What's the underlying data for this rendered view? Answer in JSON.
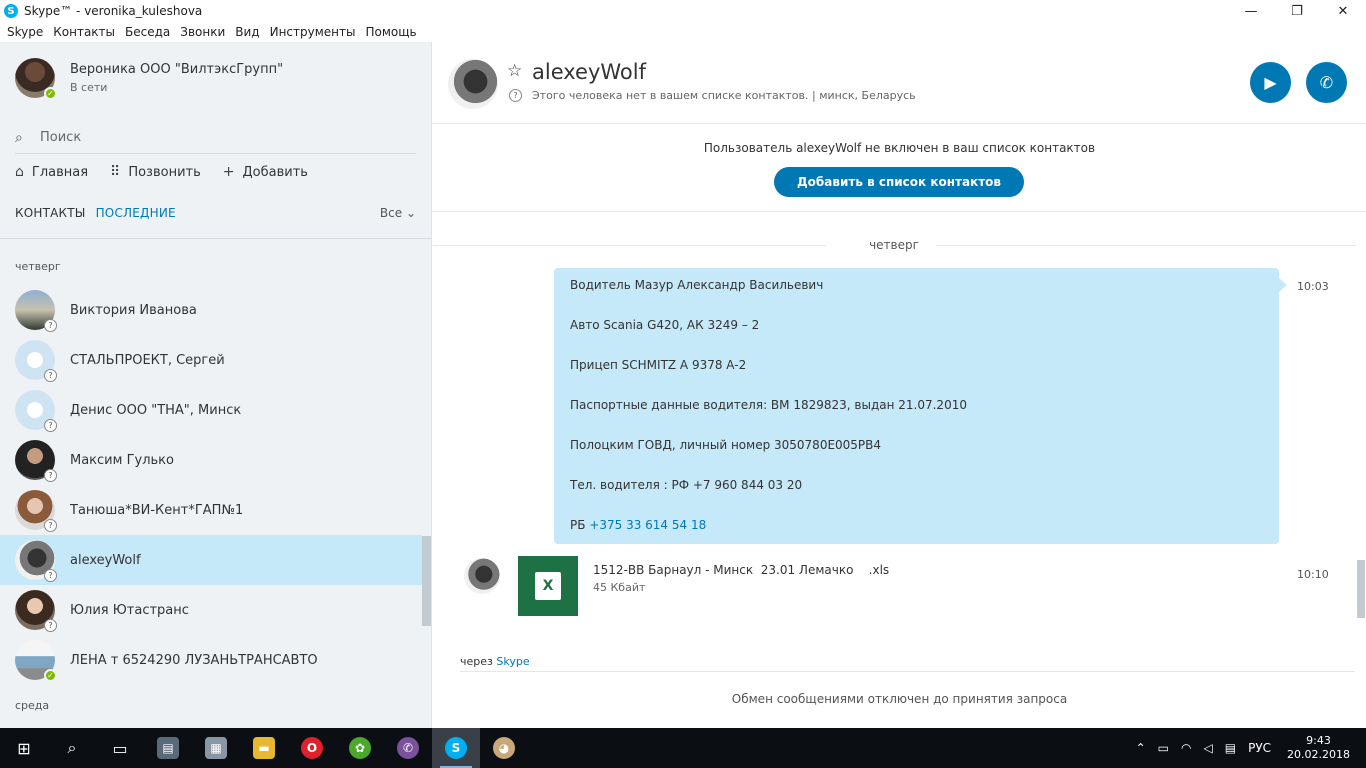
{
  "window": {
    "title": "Skype™ - veronika_kuleshova",
    "controls": {
      "minimize": "—",
      "restore": "❐",
      "close": "✕"
    }
  },
  "menu": [
    "Skype",
    "Контакты",
    "Беседа",
    "Звонки",
    "Вид",
    "Инструменты",
    "Помощь"
  ],
  "profile": {
    "name": "Вероника ООО \"ВилтэксГрупп\"",
    "status": "В сети"
  },
  "search": {
    "placeholder": "Поиск"
  },
  "nav": {
    "home": "Главная",
    "call": "Позвонить",
    "add": "Добавить"
  },
  "tabs": {
    "contacts": "КОНТАКТЫ",
    "recent": "ПОСЛЕДНИЕ",
    "filter": "Все"
  },
  "day_groups": {
    "thursday": "четверг",
    "wednesday": "среда"
  },
  "contacts": [
    {
      "name": "Виктория Иванова",
      "status": "unknown"
    },
    {
      "name": "СТАЛЬПРОЕКТ, Сергей",
      "status": "unknown"
    },
    {
      "name": "Денис ООО \"ТНА\", Минск",
      "status": "unknown"
    },
    {
      "name": "Максим Гулько",
      "status": "unknown"
    },
    {
      "name": "Танюша*ВИ-Кент*ГАП№1",
      "status": "unknown"
    },
    {
      "name": "alexeyWolf",
      "status": "unknown",
      "selected": true
    },
    {
      "name": "Юлия Ютастранс",
      "status": "unknown"
    },
    {
      "name": "ЛЕНА т 6524290 ЛУЗАНЬТРАНСАВТО",
      "status": "online"
    }
  ],
  "conversation": {
    "contact_name": "alexeyWolf",
    "info": "Этого человека нет в вашем списке контактов.",
    "location": "минск, Беларусь",
    "separator": "|",
    "notice": "Пользователь alexeyWolf не включен в ваш список контактов",
    "add_button": "Добавить в список контактов",
    "day_label": "четверг",
    "message": {
      "time": "10:03",
      "lines": [
        "Водитель Мазур Александр Васильевич",
        "Авто Scania G420, АК 3249 – 2",
        "Прицеп SCHMITZ A 9378 A-2",
        "Паспортные данные водителя: ВМ 1829823, выдан 21.07.2010",
        "Полоцким ГОВД, личный номер 3050780E005PB4",
        "Тел. водителя : РФ +7 960 844 03 20"
      ],
      "last_prefix": "РБ ",
      "last_phone": "+375 33 614 54 18"
    },
    "file": {
      "name": "1512-ВВ Барнаул - Минск  23.01 Лемачко    .xls",
      "size": "45 Кбайт",
      "time": "10:10",
      "icon_letter": "X"
    },
    "via_prefix": "через ",
    "via_link": "Skype",
    "footer": "Обмен сообщениями отключен до принятия запроса"
  },
  "taskbar": {
    "language": "РУС",
    "time": "9:43",
    "date": "20.02.2018",
    "apps": [
      "start",
      "search",
      "task-view",
      "file-manager",
      "archive",
      "explorer",
      "opera",
      "icq",
      "viber",
      "skype",
      "paint"
    ]
  },
  "colors": {
    "accent": "#0078b4",
    "bubble": "#c6e9f9",
    "sidebar": "#eef2f5",
    "excel": "#1e7145",
    "online": "#7fba00"
  }
}
